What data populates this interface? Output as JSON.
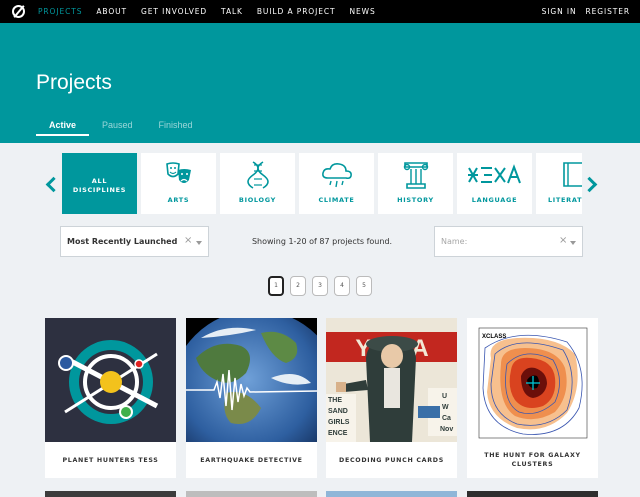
{
  "nav": {
    "links": [
      "PROJECTS",
      "ABOUT",
      "GET INVOLVED",
      "TALK",
      "BUILD A PROJECT",
      "NEWS"
    ],
    "sign_in": "SIGN IN",
    "register": "REGISTER"
  },
  "hero": {
    "title": "Projects",
    "tabs": [
      "Active",
      "Paused",
      "Finished"
    ]
  },
  "disciplines": [
    "ALL DISCIPLINES",
    "ARTS",
    "BIOLOGY",
    "CLIMATE",
    "HISTORY",
    "LANGUAGE",
    "LITERATURE"
  ],
  "filters": {
    "sort_value": "Most Recently Launched",
    "found_text": "Showing 1-20 of 87 projects found.",
    "name_placeholder": "Name:",
    "clear_symbol": "×"
  },
  "pagination": [
    "1",
    "2",
    "3",
    "4",
    "5"
  ],
  "projects": [
    {
      "title": "PLANET HUNTERS TESS"
    },
    {
      "title": "EARTHQUAKE DETECTIVE"
    },
    {
      "title": "DECODING PUNCH CARDS"
    },
    {
      "title": "THE HUNT FOR GALAXY CLUSTERS"
    }
  ],
  "poster_text": {
    "banner": "YWCA",
    "left_lines": [
      "THE",
      "SAND",
      "GIRLS",
      "ENCE"
    ],
    "right_lines": [
      "U",
      "W",
      "Ca",
      "Nov"
    ],
    "xclass_label": "XCLASS"
  },
  "colors": {
    "accent": "#00979d",
    "nav_bg": "#000000"
  }
}
